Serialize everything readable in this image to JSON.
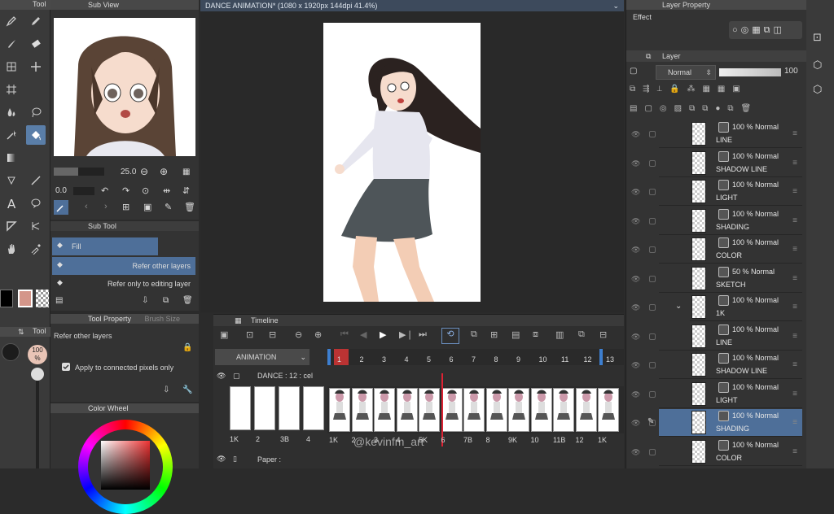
{
  "left_toolbar": {
    "title": "Tool",
    "opacity_label": "100\n%"
  },
  "sub_view": {
    "title": "Sub View"
  },
  "brush_controls": {
    "size_value": "25.0",
    "opacity_value": "0.0"
  },
  "sub_tool": {
    "title": "Sub Tool",
    "items": [
      {
        "label": "Fill"
      },
      {
        "label": "Refer other layers"
      },
      {
        "label": "Refer only to editing layer"
      }
    ]
  },
  "tool_property": {
    "title": "Tool Property",
    "tab2": "Brush Size",
    "tool_name": "Refer other layers",
    "option": "Apply to connected pixels only"
  },
  "color_wheel": {
    "title": "Color Wheel",
    "main_color": "#d4968a"
  },
  "document": {
    "tab_title": "DANCE ANIMATION* (1080 x 1920px 144dpi 41.4%)"
  },
  "timeline": {
    "title": "Timeline",
    "track_name": "ANIMATION",
    "folder_label": "DANCE : 12 : cel",
    "paper_label": "Paper :",
    "frame_numbers": [
      "1",
      "2",
      "3",
      "4",
      "5",
      "6",
      "7",
      "8",
      "9",
      "10",
      "11",
      "12",
      "13"
    ],
    "left_frames": [
      "1K",
      "2",
      "3B",
      "4"
    ],
    "cel_labels": [
      "1K",
      "2",
      "3",
      "4",
      "5K",
      "6",
      "7B",
      "8",
      "9K",
      "10",
      "11B",
      "12",
      "1K"
    ],
    "watermark": "@kevinfm_art"
  },
  "layer_property": {
    "title": "Layer Property",
    "effect_label": "Effect"
  },
  "layer_panel": {
    "title": "Layer",
    "blend_mode": "Normal",
    "opacity_value": "100",
    "layers": [
      {
        "pct": "100 % Normal",
        "name": "LINE"
      },
      {
        "pct": "100 % Normal",
        "name": "SHADOW LINE"
      },
      {
        "pct": "100 % Normal",
        "name": "LIGHT"
      },
      {
        "pct": "100 % Normal",
        "name": "SHADING"
      },
      {
        "pct": "100 % Normal",
        "name": "COLOR"
      },
      {
        "pct": "50 % Normal",
        "name": "SKETCH"
      },
      {
        "pct": "100 % Normal",
        "name": "1K"
      },
      {
        "pct": "100 % Normal",
        "name": "LINE"
      },
      {
        "pct": "100 % Normal",
        "name": "SHADOW LINE"
      },
      {
        "pct": "100 % Normal",
        "name": "LIGHT"
      },
      {
        "pct": "100 % Normal",
        "name": "SHADING"
      },
      {
        "pct": "100 % Normal",
        "name": "COLOR"
      }
    ]
  }
}
